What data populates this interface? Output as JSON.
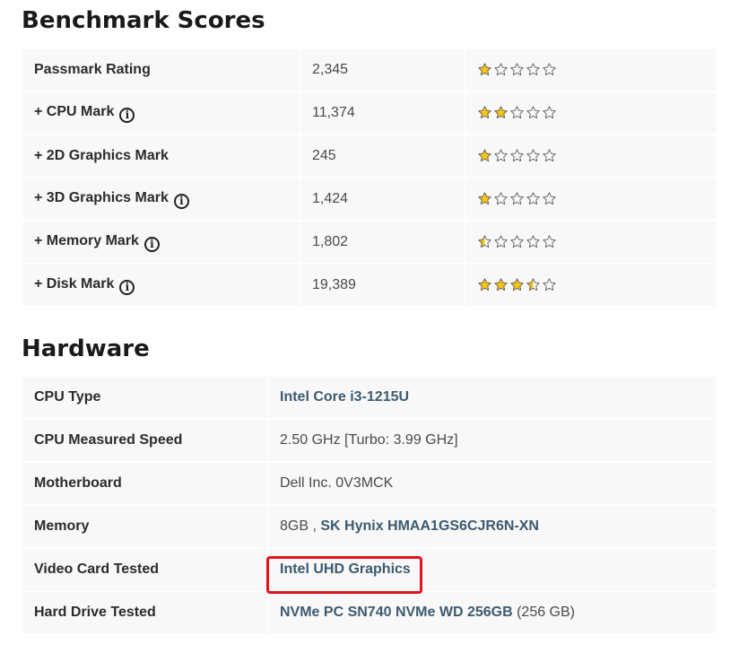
{
  "benchmark": {
    "title": "Benchmark Scores",
    "rows": [
      {
        "label": "Passmark Rating",
        "value": "2,345",
        "rating": 1,
        "info": false
      },
      {
        "label": "+ CPU Mark",
        "value": "11,374",
        "rating": 2,
        "info": true
      },
      {
        "label": "+ 2D Graphics Mark",
        "value": "245",
        "rating": 1,
        "info": false
      },
      {
        "label": "+ 3D Graphics Mark",
        "value": "1,424",
        "rating": 1,
        "info": true
      },
      {
        "label": "+ Memory Mark",
        "value": "1,802",
        "rating": 0.5,
        "info": true
      },
      {
        "label": "+ Disk Mark",
        "value": "19,389",
        "rating": 3.5,
        "info": true
      }
    ],
    "max_rating": 5,
    "star_color": "#f5c518"
  },
  "hardware": {
    "title": "Hardware",
    "rows": [
      {
        "label": "CPU Type",
        "link": "Intel Core i3-1215U",
        "plain": ""
      },
      {
        "label": "CPU Measured Speed",
        "link": "",
        "plain": "2.50 GHz [Turbo: 3.99 GHz]"
      },
      {
        "label": "Motherboard",
        "link": "",
        "plain": "Dell Inc. 0V3MCK"
      },
      {
        "label": "Memory",
        "plain_prefix": "8GB , ",
        "link": "SK Hynix HMAA1GS6CJR6N-XN",
        "plain": ""
      },
      {
        "label": "Video Card Tested",
        "link": "Intel UHD Graphics",
        "plain": ""
      },
      {
        "label": "Hard Drive Tested",
        "link": "NVMe PC SN740 NVMe WD 256GB",
        "plain": " (256 GB)"
      }
    ],
    "highlight_color": "#e0141e"
  },
  "colors": {
    "row_bg": "#f8f8f9",
    "link": "#3d5a6e"
  }
}
